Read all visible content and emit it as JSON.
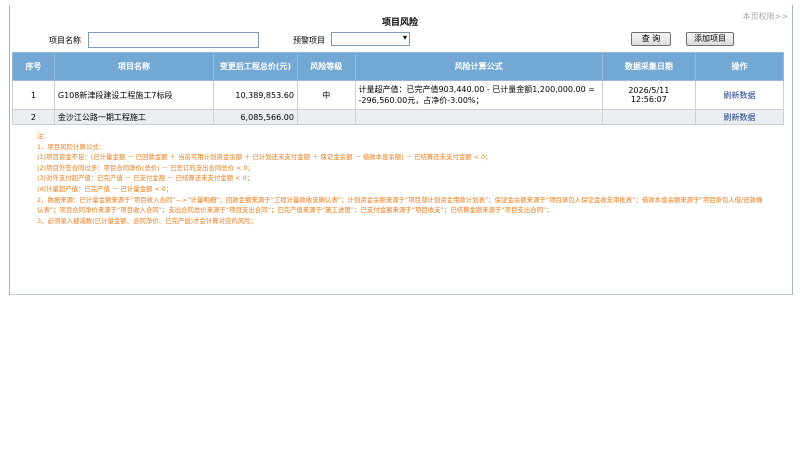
{
  "header": {
    "permission_link": "本页权限>>",
    "title": "项目风险"
  },
  "search": {
    "project_name_label": "项目名称",
    "project_name_value": "",
    "warning_label": "预警项目",
    "warning_selected": "",
    "query_button": "查 询",
    "add_button": "添加项目"
  },
  "table": {
    "columns": [
      "序号",
      "项目名称",
      "变更后工程总价(元)",
      "风险等级",
      "风险计算公式",
      "数据采集日期",
      "操作"
    ],
    "rows": [
      {
        "index": "1",
        "name": "G108新津段建设工程施工7标段",
        "total": "10,389,853.60",
        "level": "中",
        "formula": "计量超产值：已完产值903,440.00 - 已计量金额1,200,000.00 = -296,560.00元，占净价-3.00%；",
        "date": "2026/5/11",
        "time": "12:56:07",
        "action": "刷新数据"
      },
      {
        "index": "2",
        "name": "金沙江公路一期工程施工",
        "total": "6,085,566.00",
        "level": "",
        "formula": "",
        "date": "",
        "time": "",
        "action": "刷新数据"
      }
    ]
  },
  "notes": [
    "注：",
    "1、项目风险计算公式：",
    "(1)项目资金不足：(已计量金额 － 已回款金额 ＋ 当前可用计划资金余额 ＋ 已计划还未支付金额 ＋ 保证金余额 － 借款本息余额) － 已结算还未支付金额 < 0；",
    "(2)项目外签合同过多：项目合同净价(总价) － 已签订的支出合同总价 < 0；",
    "(3)对外支付超产值：已完产值 － 已支付金额 － 已结算还未支付金额 < 0；",
    "(4)计量超产值：已完产值 － 已计量金额 < 0；",
    "2、数据来源：已计量金额来源于“项目收入合同”—>“计量明细”；回款金额来源于“工程计量款收支确认表”；计划资金余额来源于“项目部计划资金用款计划表”；保证金余额来源于“项目承包人保证金收支审批表”；借款本息余额来源于“项目承包人借/还款确认表”；项目合同净价来源于“项目收入合同”；支出合同总价来源于“项目支出合同”；已完产值来源于“施工进度”；已支付金额来源于“项目收支”；已结算金额来源于“项目支出合同”；",
    "3、必须录入被减数(已计量金额、合同净价、已完产值)才会计算对应的风险；"
  ]
}
